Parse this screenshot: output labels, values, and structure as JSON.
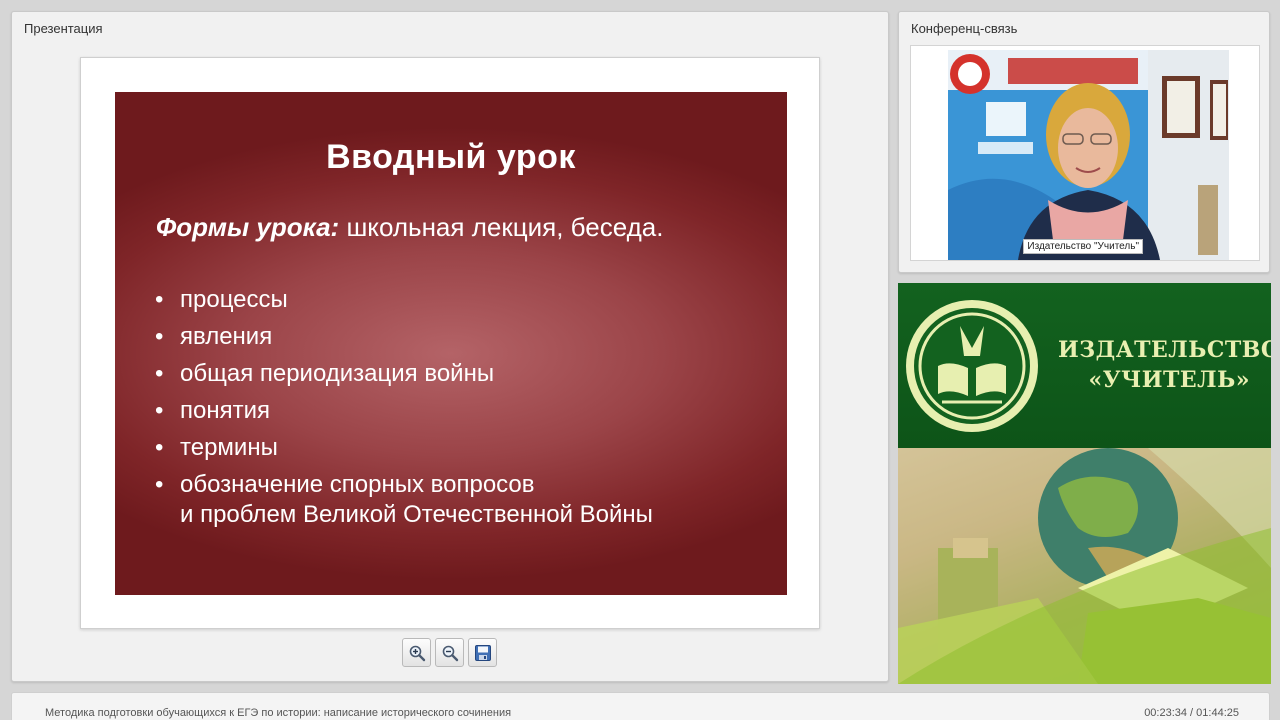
{
  "presentation": {
    "title": "Презентация",
    "slide": {
      "title": "Вводный урок",
      "forms_label": "Формы урока:",
      "forms_text": " школьная лекция, беседа.",
      "bullet_char": "•",
      "bullets": [
        "процессы",
        "явления",
        "общая периодизация войны",
        "понятия",
        "термины",
        "обозначение спорных вопросов\nи проблем Великой Отечественной Войны"
      ]
    },
    "toolbar": {
      "zoom_in_icon": "zoom-in-icon",
      "zoom_out_icon": "zoom-out-icon",
      "save_icon": "floppy-disk-icon"
    }
  },
  "conference": {
    "title": "Конференц-связь",
    "video_label": "Издательство \"Учитель\""
  },
  "banner": {
    "line1": "ИЗДАТЕЛЬСТВО",
    "line2": "«УЧИТЕЛЬ»",
    "colors": {
      "green": "#13621f",
      "text": "#e9efb1"
    }
  },
  "footer": {
    "course_title": "Методика подготовки обучающихся к ЕГЭ по истории: написание исторического сочинения",
    "timecode": "00:23:34 / 01:44:25"
  },
  "colors": {
    "slide_red": "#8b3034",
    "panel_bg": "#f1f1f1"
  }
}
